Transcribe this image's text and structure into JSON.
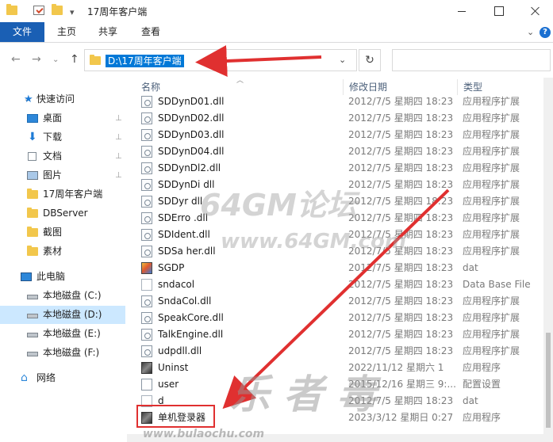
{
  "window": {
    "title": "17周年客户端"
  },
  "ribbon": {
    "tabs": [
      "文件",
      "主页",
      "共享",
      "查看"
    ],
    "help": "?"
  },
  "address": {
    "path": "D:\\17周年客户端",
    "search_placeholder": ""
  },
  "nav": {
    "quick_access": "快速访问",
    "pinned": [
      "桌面",
      "下载",
      "文档",
      "图片"
    ],
    "folders": [
      "17周年客户端",
      "DBServer",
      "截图",
      "素材"
    ],
    "this_pc": "此电脑",
    "drives": [
      "本地磁盘 (C:)",
      "本地磁盘 (D:)",
      "本地磁盘 (E:)",
      "本地磁盘 (F:)"
    ],
    "network": "网络"
  },
  "columns": {
    "name": "名称",
    "date": "修改日期",
    "type": "类型"
  },
  "files": [
    {
      "name": "SDDynD01.dll",
      "date": "2012/7/5 星期四 18:23",
      "type": "应用程序扩展",
      "icon": "dll-icon"
    },
    {
      "name": "SDDynD02.dll",
      "date": "2012/7/5 星期四 18:23",
      "type": "应用程序扩展",
      "icon": "dll-icon"
    },
    {
      "name": "SDDynD03.dll",
      "date": "2012/7/5 星期四 18:23",
      "type": "应用程序扩展",
      "icon": "dll-icon"
    },
    {
      "name": "SDDynD04.dll",
      "date": "2012/7/5 星期四 18:23",
      "type": "应用程序扩展",
      "icon": "dll-icon"
    },
    {
      "name": "SDDynDl2.dll",
      "date": "2012/7/5 星期四 18:23",
      "type": "应用程序扩展",
      "icon": "dll-icon"
    },
    {
      "name": "SDDynDi  dll",
      "date": "2012/7/5 星期四 18:23",
      "type": "应用程序扩展",
      "icon": "dll-icon"
    },
    {
      "name": "SDDyr    dll",
      "date": "2012/7/5 星期四 18:23",
      "type": "应用程序扩展",
      "icon": "dll-icon"
    },
    {
      "name": "SDErro    .dll",
      "date": "2012/7/5 星期四 18:23",
      "type": "应用程序扩展",
      "icon": "dll-icon"
    },
    {
      "name": "SDIdent.dll",
      "date": "2012/7/5 星期四 18:23",
      "type": "应用程序扩展",
      "icon": "dll-icon"
    },
    {
      "name": "SDSa    her.dll",
      "date": "2012/7/5 星期四 18:23",
      "type": "应用程序扩展",
      "icon": "dll-icon"
    },
    {
      "name": "SGDP",
      "date": "2012/7/5 星期四 18:23",
      "type": "dat",
      "icon": "game-icon"
    },
    {
      "name": "sndacol",
      "date": "2012/7/5 星期四 18:23",
      "type": "Data Base File",
      "icon": "blank-file-icon"
    },
    {
      "name": "SndaCol.dll",
      "date": "2012/7/5 星期四 18:23",
      "type": "应用程序扩展",
      "icon": "dll-icon"
    },
    {
      "name": "SpeakCore.dll",
      "date": "2012/7/5 星期四 18:23",
      "type": "应用程序扩展",
      "icon": "dll-icon"
    },
    {
      "name": "TalkEngine.dll",
      "date": "2012/7/5 星期四 18:23",
      "type": "应用程序扩展",
      "icon": "dll-icon"
    },
    {
      "name": "udpdll.dll",
      "date": "2012/7/5 星期四 18:23",
      "type": "应用程序扩展",
      "icon": "dll-icon"
    },
    {
      "name": "Uninst",
      "date": "2022/11/12 星期六 1",
      "type": "应用程序",
      "icon": "app-icon"
    },
    {
      "name": "user",
      "date": "2015/12/16 星期三 9:...",
      "type": "配置设置",
      "icon": "gear-file-icon"
    },
    {
      "name": "d",
      "date": "2012/7/5 星期四 18:23",
      "type": "dat",
      "icon": "blank-file-icon"
    },
    {
      "name": "单机登录器",
      "date": "2023/3/12 星期日 0:27",
      "type": "应用程序",
      "icon": "app-icon"
    }
  ],
  "watermarks": {
    "line1": "64GM论坛",
    "line2": "www.64GM.com",
    "line3": "乐 者 毒",
    "line4": "www.bulaochu.com"
  },
  "colors": {
    "accent": "#1a5fb4",
    "selection": "#0078d7",
    "annotation": "#e03030"
  }
}
